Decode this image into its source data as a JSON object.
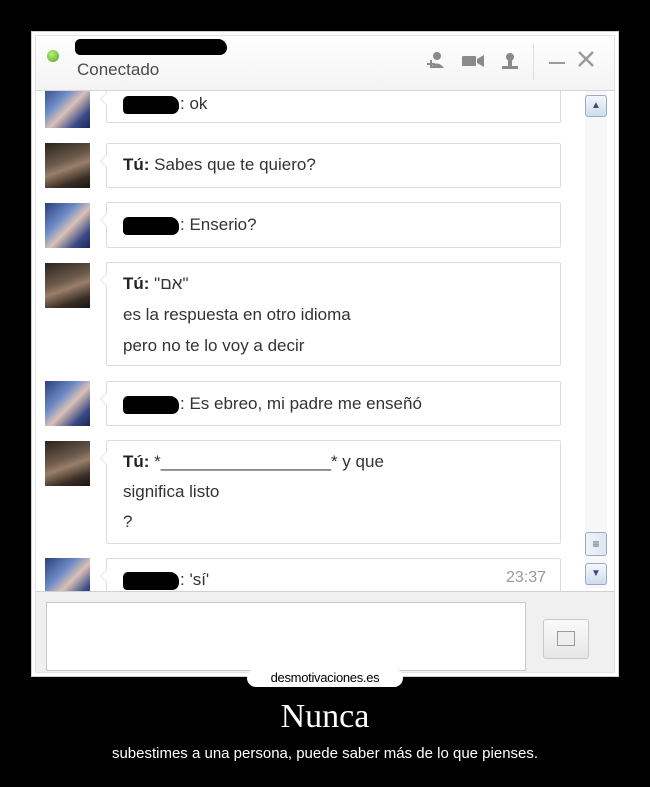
{
  "header": {
    "status": "Conectado",
    "icons": [
      "add-contact-icon",
      "video-icon",
      "profile-icon",
      "minimize-icon",
      "close-icon"
    ]
  },
  "messages": [
    {
      "sender": "",
      "avatar": "friend",
      "lines": [
        ": ok"
      ]
    },
    {
      "sender": "Tú:",
      "avatar": "me",
      "lines": [
        "Sabes que te quiero?"
      ]
    },
    {
      "sender": "",
      "avatar": "friend",
      "lines": ": Enserio?"
    },
    {
      "sender": "Tú:",
      "avatar": "me",
      "lines": [
        "\"אם\"",
        "es la respuesta en otro idioma",
        "pero no te lo voy a decir"
      ]
    },
    {
      "sender": "",
      "avatar": "friend",
      "lines": [
        ": Es ebreo, mi padre me enseñó"
      ]
    },
    {
      "sender": "Tú:",
      "avatar": "me",
      "lines": [
        "*__________________* y que",
        "significa listo",
        "?"
      ]
    },
    {
      "sender": "",
      "avatar": "friend",
      "lines": [
        ": 'sí'"
      ],
      "time": "23:37"
    }
  ],
  "composer": {
    "value": "",
    "emoji": "smiley-icon",
    "image_button": "image-icon"
  },
  "scrollbar_icons": {
    "up": "▲",
    "grip": "≡",
    "down": "▼"
  },
  "poster": {
    "site": "desmotivaciones.es",
    "title": "Nunca",
    "subtitle": "subestimes a una persona, puede saber más de lo que pienses."
  }
}
